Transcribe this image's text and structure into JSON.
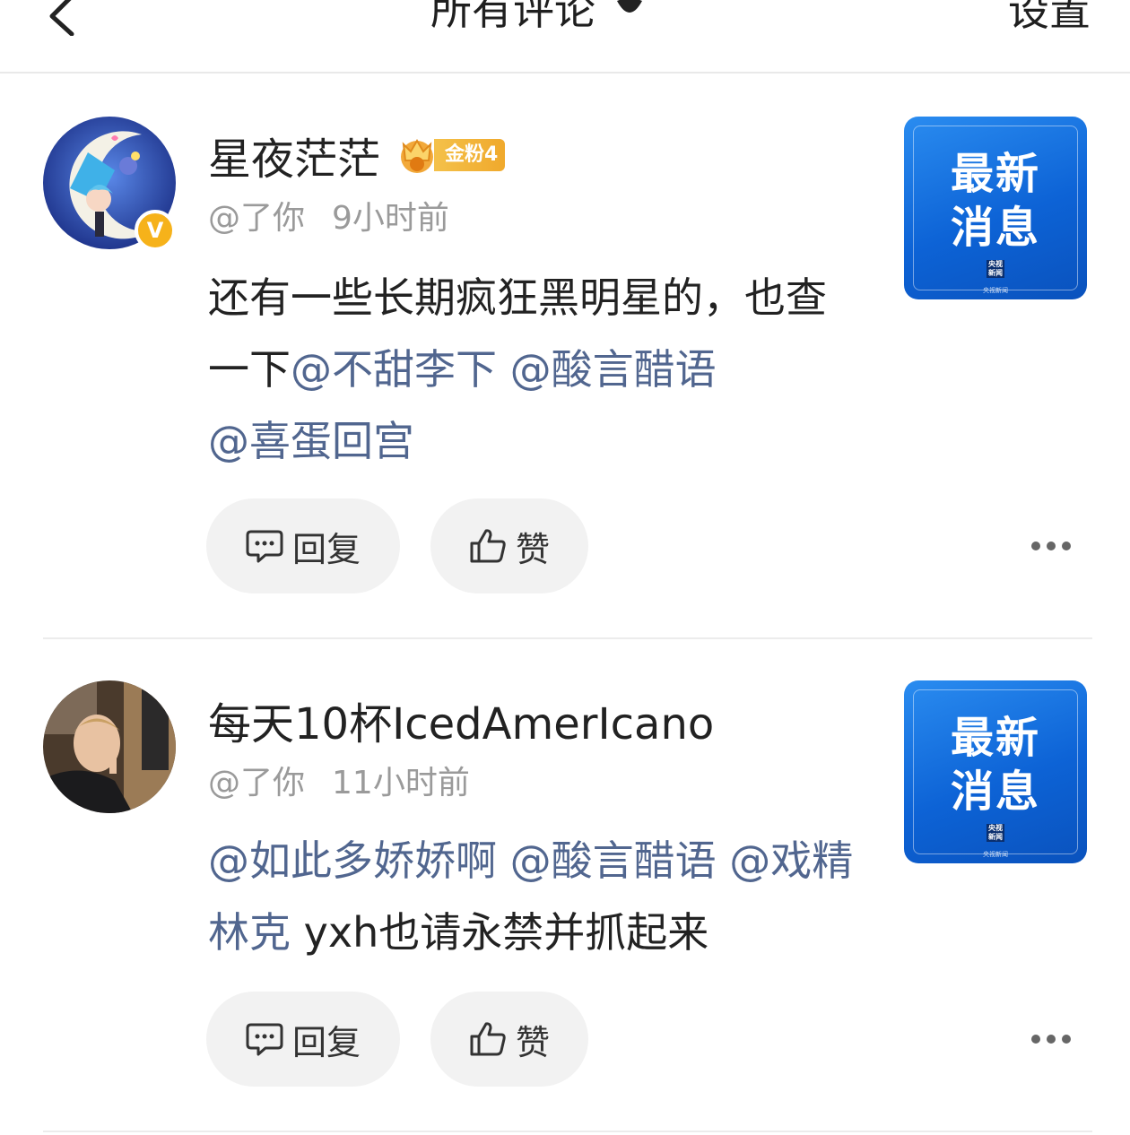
{
  "header": {
    "back_icon": "chevron-left-icon",
    "title": "所有评论",
    "title_caret_icon": "caret-down-icon",
    "settings_label": "设置"
  },
  "comments": [
    {
      "username": "星夜茫茫",
      "verified_icon": "verified-v-icon",
      "verified_label": "V",
      "fan_badge": "金粉4",
      "source": "@了你",
      "time": "9小时前",
      "text_parts": [
        "还有一些长期疯狂黑明星的，也查一下",
        "@不甜李下",
        " ",
        "@酸言醋语",
        " ",
        "@喜蛋回宫"
      ],
      "thumbnail": {
        "line1": "最新",
        "line2": "消息",
        "logo": "央视新闻"
      },
      "reply_label": "回复",
      "like_label": "赞",
      "more_icon": "more-dots-icon"
    },
    {
      "username": "每天10杯IcedAmerIcano",
      "source": "@了你",
      "time": "11小时前",
      "text_parts": [
        "@如此多娇娇啊",
        " ",
        "@酸言醋语",
        " ",
        "@戏精林克",
        " yxh也请永禁并抓起来"
      ],
      "thumbnail": {
        "line1": "最新",
        "line2": "消息",
        "logo": "央视新闻"
      },
      "reply_label": "回复",
      "like_label": "赞",
      "more_icon": "more-dots-icon"
    }
  ],
  "colors": {
    "mention": "#51668f",
    "meta": "#9a9a9a",
    "pill_bg": "#f2f2f2",
    "thumb_blue": "#1673e0",
    "fan_badge": "#f0a92c"
  }
}
